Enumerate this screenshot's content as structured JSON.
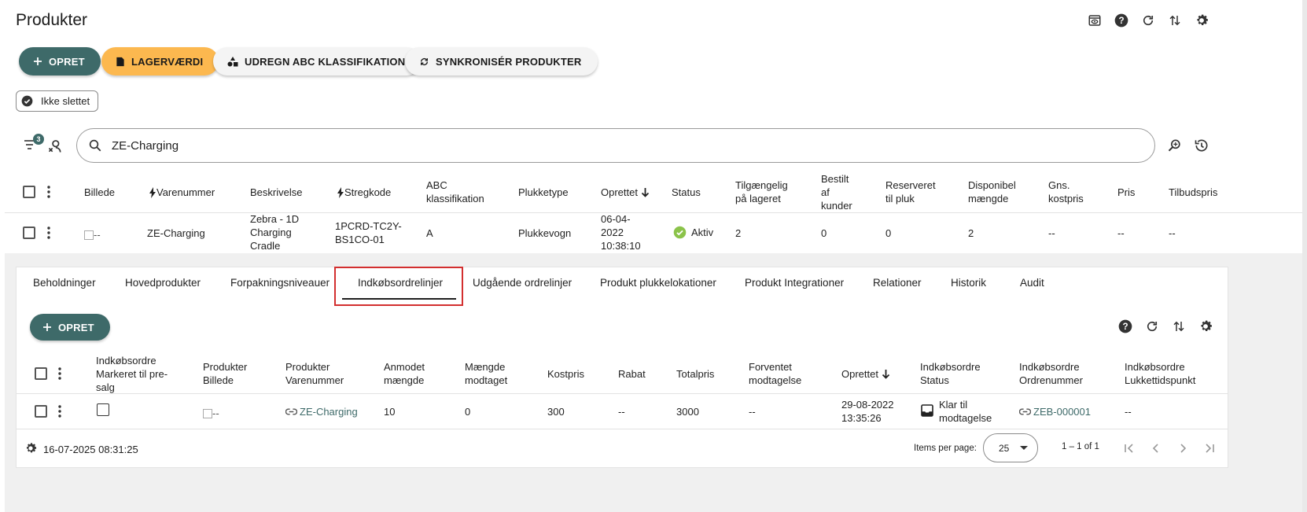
{
  "page": {
    "title": "Produkter"
  },
  "header_icons": [
    "preview-icon",
    "help-icon",
    "refresh-icon",
    "sort-icon",
    "settings-icon"
  ],
  "actions": {
    "create": "OPRET",
    "stock_value": "LAGERVÆRDI",
    "abc": "UDREGN ABC KLASSIFIKATION",
    "sync": "SYNKRONISÉR PRODUKTER"
  },
  "filter_chip": {
    "label": "Ikke slettet"
  },
  "filter_badge": "3",
  "search": {
    "value": "ZE-Charging",
    "placeholder": ""
  },
  "products_table": {
    "headers": {
      "image": "Billede",
      "item_number": "Varenummer",
      "description": "Beskrivelse",
      "barcode": "Stregkode",
      "abc_l1": "ABC",
      "abc_l2": "klassifikation",
      "pick_type": "Plukketype",
      "created": "Oprettet",
      "status": "Status",
      "avail_l1": "Tilgængelig",
      "avail_l2": "på lageret",
      "ordered_l1": "Bestilt",
      "ordered_l2": "af",
      "ordered_l3": "kunder",
      "reserved_l1": "Reserveret",
      "reserved_l2": "til pluk",
      "disp_l1": "Disponibel",
      "disp_l2": "mængde",
      "avgcost_l1": "Gns.",
      "avgcost_l2": "kostpris",
      "price": "Pris",
      "offer_price": "Tilbudspris"
    },
    "row": {
      "image_alt": "--",
      "item_number": "ZE-Charging",
      "desc_l1": "Zebra - 1D",
      "desc_l2": "Charging",
      "desc_l3": "Cradle",
      "barcode_l1": "1PCRD-TC2Y-",
      "barcode_l2": "BS1CO-01",
      "abc": "A",
      "pick_type": "Plukkevogn",
      "created_l1": "06-04-",
      "created_l2": "2022",
      "created_l3": "10:38:10",
      "status": "Aktiv",
      "available": "2",
      "ordered": "0",
      "reserved": "0",
      "disposable": "2",
      "avg_cost": "--",
      "price": "--",
      "offer_price": "--"
    }
  },
  "tabs": [
    "Beholdninger",
    "Hovedprodukter",
    "Forpakningsniveauer",
    "Indkøbsordrelinjer",
    "Udgående ordrelinjer",
    "Produkt plukkelokationer",
    "Produkt Integrationer",
    "Relationer",
    "Historik",
    "Audit"
  ],
  "active_tab": "Indkøbsordrelinjer",
  "sub": {
    "create": "OPRET",
    "headers": {
      "presale_l1": "Indkøbsordre",
      "presale_l2": "Markeret til pre-",
      "presale_l3": "salg",
      "img_l1": "Produkter",
      "img_l2": "Billede",
      "itemno_l1": "Produkter",
      "itemno_l2": "Varenummer",
      "req_l1": "Anmodet",
      "req_l2": "mængde",
      "recv_l1": "Mængde",
      "recv_l2": "modtaget",
      "cost": "Kostpris",
      "discount": "Rabat",
      "total": "Totalpris",
      "exp_l1": "Forventet",
      "exp_l2": "modtagelse",
      "created": "Oprettet",
      "postatus_l1": "Indkøbsordre",
      "postatus_l2": "Status",
      "pono_l1": "Indkøbsordre",
      "pono_l2": "Ordrenummer",
      "close_l1": "Indkøbsordre",
      "close_l2": "Lukkettidspunkt"
    },
    "row": {
      "image_alt": "--",
      "item_number": "ZE-Charging",
      "requested": "10",
      "received": "0",
      "cost": "300",
      "discount": "--",
      "total": "3000",
      "expected": "--",
      "created_l1": "29-08-2022",
      "created_l2": "13:35:26",
      "status_l1": "Klar til",
      "status_l2": "modtagelse",
      "po_number": "ZEB-000001",
      "close_time": "--"
    },
    "footer": {
      "timestamp": "16-07-2025 08:31:25",
      "items_per_page_label": "Items per page:",
      "items_per_page": "25",
      "range": "1 – 1 of 1"
    }
  },
  "colors": {
    "primary": "#3e6a69",
    "warn": "#fcb84f",
    "status_ok": "#8bc34a",
    "highlight": "#d32f2f"
  }
}
